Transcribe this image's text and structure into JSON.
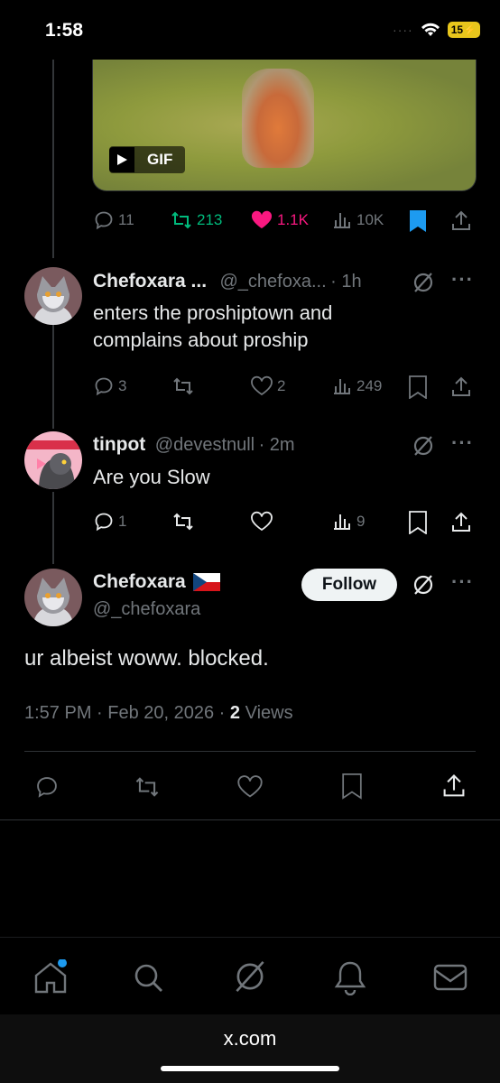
{
  "status": {
    "time": "1:58",
    "battery": "15"
  },
  "gif_tweet": {
    "gif_label": "GIF",
    "actions": {
      "replies": "11",
      "reposts": "213",
      "likes": "1.1K",
      "views": "10K"
    }
  },
  "reply1": {
    "name": "Chefoxara ...",
    "handle": "@_chefoxa...",
    "time": "· 1h",
    "text_line1": "enters the proshiptown and",
    "text_line2": "complains about proship",
    "actions": {
      "replies": "3",
      "likes": "2",
      "views": "249"
    }
  },
  "reply2": {
    "name": "tinpot",
    "handle": "@devestnull",
    "time": "· 2m",
    "text": "Are you Slow",
    "actions": {
      "replies": "1",
      "views": "9"
    }
  },
  "main_tweet": {
    "name": "Chefoxara",
    "handle": "@_chefoxara",
    "follow_label": "Follow",
    "text": "ur albeist woww. blocked.",
    "timestamp": "1:57 PM · Feb 20, 2026 · ",
    "views_count": "2",
    "views_label": "Views"
  },
  "browser": {
    "url": "x.com"
  },
  "colors": {
    "accent": "#1d9bf0",
    "like": "#f91880",
    "repost": "#00ba7c",
    "muted": "#71767b"
  }
}
